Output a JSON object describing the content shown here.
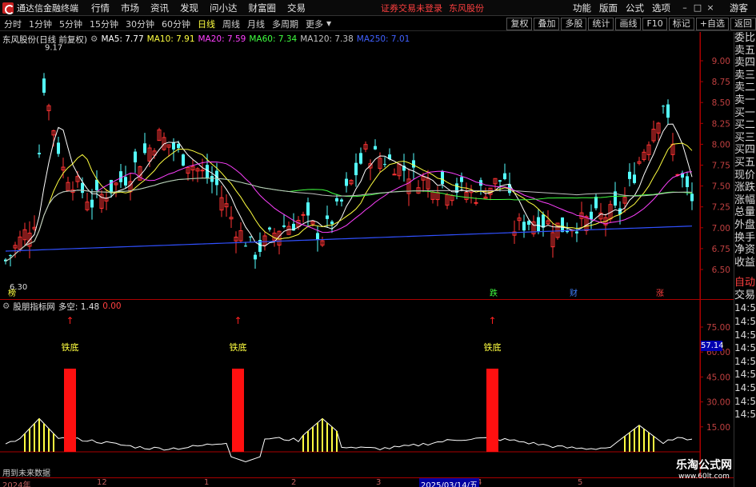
{
  "app": {
    "title": "通达信金融终端",
    "menus": [
      "行情",
      "市场",
      "资讯",
      "发现",
      "问小达",
      "财富圈",
      "交易"
    ],
    "alert": "证券交易未登录",
    "stock_tag": "东风股份",
    "right_menus": [
      "功能",
      "版面",
      "公式",
      "选项"
    ],
    "guest": "游客"
  },
  "toolbar": {
    "periods": [
      "分时",
      "1分钟",
      "5分钟",
      "15分钟",
      "30分钟",
      "60分钟",
      "日线",
      "周线",
      "月线",
      "多周期",
      "更多"
    ],
    "active_period": "日线",
    "buttons": [
      "复权",
      "叠加",
      "多股",
      "统计",
      "画线",
      "F10",
      "标记",
      "+自选",
      "返回"
    ]
  },
  "chart": {
    "stock_title": "东风股份(日线 前复权)",
    "ma": [
      {
        "label": "MA5: 7.77",
        "color": "#ffffff"
      },
      {
        "label": "MA10: 7.91",
        "color": "#ffff40"
      },
      {
        "label": "MA20: 7.59",
        "color": "#ff40ff"
      },
      {
        "label": "MA60: 7.34",
        "color": "#40ff40"
      },
      {
        "label": "MA120: 7.38",
        "color": "#c0c0c0"
      },
      {
        "label": "MA250: 7.01",
        "color": "#4060ff"
      }
    ],
    "yticks": [
      "9.00",
      "8.75",
      "8.50",
      "8.25",
      "8.00",
      "7.75",
      "7.50",
      "7.25",
      "7.00",
      "6.75",
      "6.50"
    ],
    "high_label": "9.17",
    "low_label": "6.30",
    "event_labels": [
      {
        "text": "榜",
        "color": "#ffff40"
      },
      {
        "text": "跌",
        "color": "#40ff40"
      },
      {
        "text": "财",
        "color": "#4080ff"
      },
      {
        "text": "涨",
        "color": "#ff4040"
      }
    ]
  },
  "indicator": {
    "name": "股朋指标网",
    "duokong": "多空: 1.48",
    "zero": "0.00",
    "yticks": [
      "75.00",
      "60.00",
      "45.00",
      "30.00",
      "15.00"
    ],
    "signal_text": "铁底",
    "current_value": "57.14",
    "future_text": "用到未来数据"
  },
  "dates": {
    "ticks": [
      "2024年",
      "12",
      "1",
      "2",
      "3",
      "4",
      "5"
    ],
    "highlight": "2025/03/14/五"
  },
  "right_panel": {
    "items": [
      "委比",
      "卖五",
      "卖四",
      "卖三",
      "卖二",
      "卖一",
      "买一",
      "买二",
      "买三",
      "买四",
      "买五",
      "现价",
      "涨跌",
      "涨幅",
      "总量",
      "外盘",
      "换手",
      "净资",
      "收益"
    ],
    "auto_label": "自动",
    "trade_label": "交易",
    "times": [
      "14:56",
      "14:56",
      "14:56",
      "14:56",
      "14:56",
      "14:56",
      "14:56",
      "14:56",
      "14:56",
      "14:56",
      "14:56"
    ]
  },
  "watermark": {
    "main": "乐淘公式网",
    "sub": "www.60lt.com"
  }
}
